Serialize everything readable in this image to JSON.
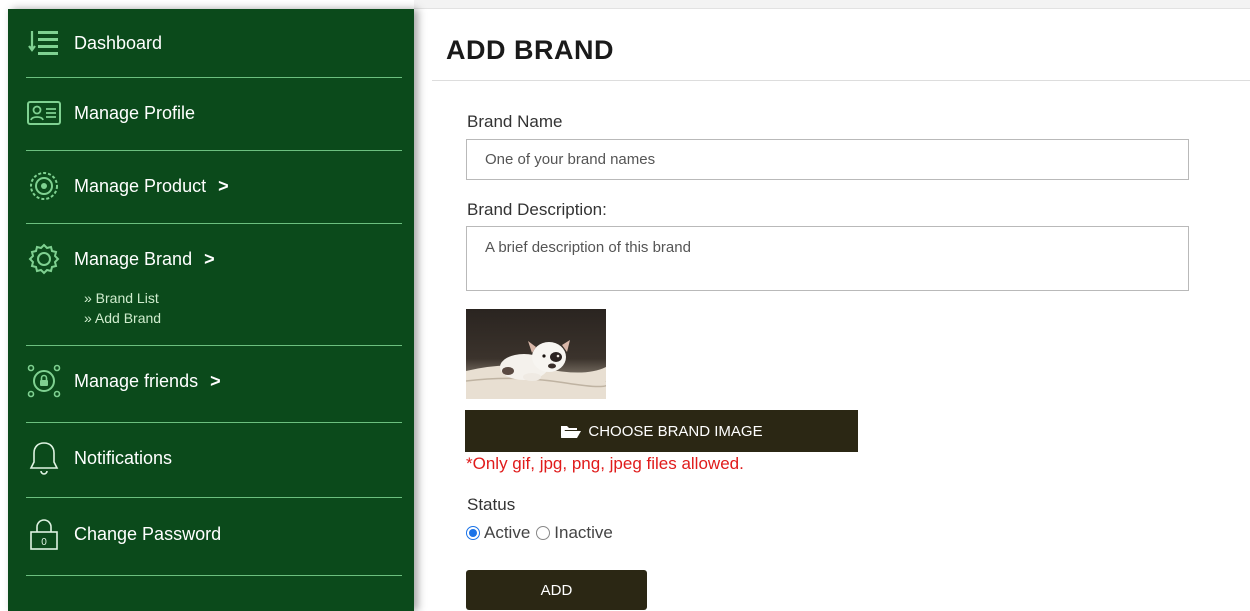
{
  "sidebar": {
    "items": [
      {
        "label": "Dashboard",
        "icon": "list-icon"
      },
      {
        "label": "Manage Profile",
        "icon": "id-card-icon"
      },
      {
        "label": "Manage Product",
        "icon": "target-icon",
        "chevron": ">"
      },
      {
        "label": "Manage Brand",
        "icon": "gear-icon",
        "chevron": ">"
      },
      {
        "label": "Manage friends",
        "icon": "lock-network-icon",
        "chevron": ">"
      },
      {
        "label": "Notifications",
        "icon": "bell-icon"
      },
      {
        "label": "Change Password",
        "icon": "padlock-icon"
      }
    ],
    "brand_subitems": [
      "» Brand List",
      "» Add Brand"
    ]
  },
  "page": {
    "title": "ADD BRAND"
  },
  "form": {
    "brand_name_label": "Brand Name",
    "brand_name_placeholder": "One of your brand names",
    "brand_description_label": "Brand Description:",
    "brand_description_placeholder": "A brief description of this brand",
    "choose_image_label": "CHOOSE BRAND IMAGE",
    "file_hint": "*Only gif, jpg, png, jpeg files allowed.",
    "status_label": "Status",
    "status_options": [
      "Active",
      "Inactive"
    ],
    "status_selected": "Active",
    "submit_label": "ADD"
  },
  "colors": {
    "sidebar_bg": "#0b4a1b",
    "button_bg": "#2b2714",
    "hint_red": "#e01b1b"
  }
}
